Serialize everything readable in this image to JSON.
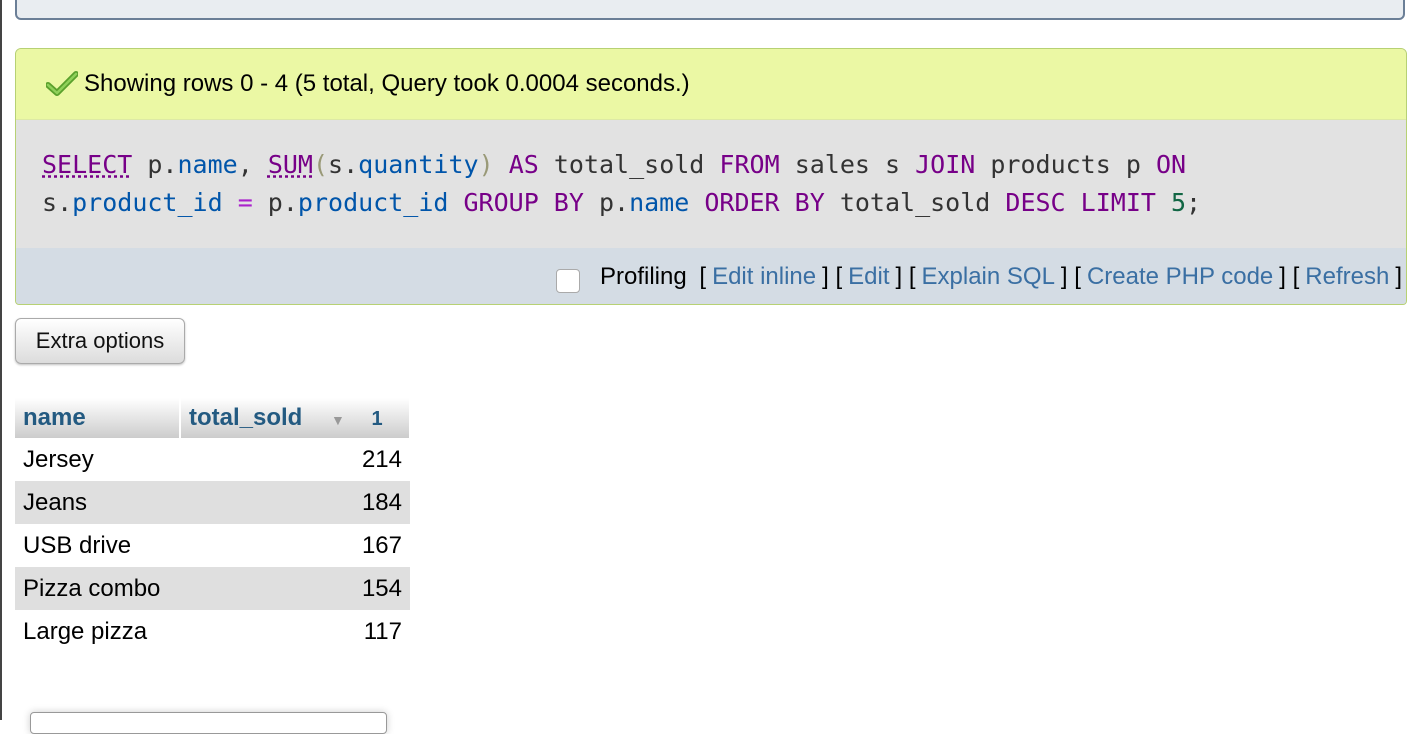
{
  "message": {
    "text": "Showing rows 0 - 4 (5 total, Query took 0.0004 seconds.)",
    "icon": "check-icon",
    "success_color": "#5aa02c"
  },
  "sql": {
    "line1": [
      {
        "t": "SELECT",
        "c": "fn"
      },
      {
        "t": " p",
        "c": "dim"
      },
      {
        "t": ".",
        "c": "dim"
      },
      {
        "t": "name",
        "c": "prop"
      },
      {
        "t": ", ",
        "c": "dim"
      },
      {
        "t": "SUM",
        "c": "fn"
      },
      {
        "t": "(",
        "c": "paren"
      },
      {
        "t": "s",
        "c": "dim"
      },
      {
        "t": ".",
        "c": "dim"
      },
      {
        "t": "quantity",
        "c": "prop"
      },
      {
        "t": ")",
        "c": "paren"
      },
      {
        "t": " AS",
        "c": "kw"
      },
      {
        "t": " total_sold",
        "c": "dim"
      },
      {
        "t": " FROM",
        "c": "kw"
      },
      {
        "t": " sales s",
        "c": "dim"
      },
      {
        "t": " JOIN",
        "c": "kw"
      },
      {
        "t": " products p",
        "c": "dim"
      },
      {
        "t": " ON",
        "c": "kw"
      }
    ],
    "line2": [
      {
        "t": "s",
        "c": "dim"
      },
      {
        "t": ".",
        "c": "dim"
      },
      {
        "t": "product_id",
        "c": "prop"
      },
      {
        "t": " = ",
        "c": "op"
      },
      {
        "t": "p",
        "c": "dim"
      },
      {
        "t": ".",
        "c": "dim"
      },
      {
        "t": "product_id",
        "c": "prop"
      },
      {
        "t": " GROUP BY",
        "c": "kw"
      },
      {
        "t": " p",
        "c": "dim"
      },
      {
        "t": ".",
        "c": "dim"
      },
      {
        "t": "name",
        "c": "prop"
      },
      {
        "t": " ORDER BY",
        "c": "kw"
      },
      {
        "t": " total_sold",
        "c": "dim"
      },
      {
        "t": " DESC",
        "c": "kw"
      },
      {
        "t": " LIMIT",
        "c": "kw"
      },
      {
        "t": " 5",
        "c": "num"
      },
      {
        "t": ";",
        "c": "dim"
      }
    ]
  },
  "toolbar": {
    "profiling_label": "Profiling",
    "links": [
      "Edit inline",
      "Edit",
      "Explain SQL",
      "Create PHP code",
      "Refresh"
    ]
  },
  "extra_options_label": "Extra options",
  "table": {
    "headers": [
      "name",
      "total_sold"
    ],
    "sort_order": "1",
    "rows": [
      {
        "name": "Jersey",
        "total_sold": "214"
      },
      {
        "name": "Jeans",
        "total_sold": "184"
      },
      {
        "name": "USB drive",
        "total_sold": "167"
      },
      {
        "name": "Pizza combo",
        "total_sold": "154"
      },
      {
        "name": "Large pizza",
        "total_sold": "117"
      }
    ]
  }
}
